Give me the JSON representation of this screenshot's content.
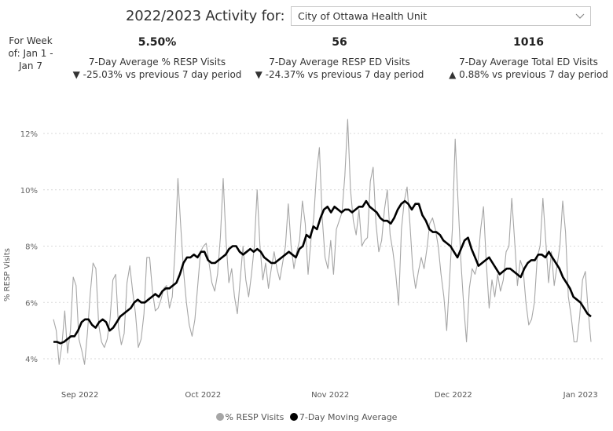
{
  "header": {
    "title": "2022/2023 Activity for:",
    "dropdown_value": "City of Ottawa Health Unit",
    "dropdown_icon": "chevron-down-icon",
    "week_label": "For Week of: Jan 1 - Jan 7"
  },
  "kpis": [
    {
      "value": "5.50%",
      "label": "7-Day Average % RESP Visits",
      "direction": "down",
      "arrow": "▼",
      "change": "-25.03% vs previous 7 day period"
    },
    {
      "value": "56",
      "label": "7-Day Average RESP ED Visits",
      "direction": "down",
      "arrow": "▼",
      "change": "-24.37% vs previous 7 day period"
    },
    {
      "value": "1016",
      "label": "7-Day Average Total ED Visits",
      "direction": "up",
      "arrow": "▲",
      "change": "0.88% vs previous 7 day period"
    }
  ],
  "colors": {
    "raw": "#a6a6a6",
    "avg": "#000000",
    "grid": "#d9d9d9"
  },
  "chart_data": {
    "type": "line",
    "title": "",
    "xlabel": "",
    "ylabel": "% RESP Visits",
    "ylim": [
      4,
      12
    ],
    "yticks": [
      4,
      6,
      8,
      10,
      12
    ],
    "ytick_labels": [
      "4%",
      "6%",
      "8%",
      "10%",
      "12%"
    ],
    "x_start": "2022-08-29",
    "x_end": "2023-01-07",
    "xticks": [
      "2022-09-01",
      "2022-10-01",
      "2022-11-01",
      "2022-12-01",
      "2023-01-01"
    ],
    "xtick_labels": [
      "Sep 2022",
      "Oct 2022",
      "Nov 2022",
      "Dec 2022",
      "Jan 2023"
    ],
    "grid": true,
    "legend_position": "bottom",
    "series": [
      {
        "name": "% RESP Visits",
        "values": [
          5.4,
          5.0,
          3.8,
          4.5,
          5.7,
          4.2,
          5.0,
          6.9,
          6.6,
          4.7,
          4.3,
          3.8,
          4.9,
          6.3,
          7.4,
          7.2,
          5.2,
          4.6,
          4.4,
          4.7,
          5.4,
          6.8,
          7.0,
          5.1,
          4.5,
          4.9,
          6.7,
          7.3,
          6.4,
          5.6,
          4.4,
          4.7,
          5.6,
          7.6,
          7.6,
          6.4,
          5.7,
          5.8,
          6.1,
          6.5,
          6.6,
          5.8,
          6.2,
          7.9,
          10.4,
          8.7,
          7.1,
          6.0,
          5.2,
          4.8,
          5.4,
          6.6,
          7.8,
          8.0,
          8.1,
          7.4,
          6.7,
          6.4,
          7.0,
          8.3,
          10.4,
          8.2,
          6.7,
          7.2,
          6.2,
          5.6,
          6.8,
          8.0,
          6.8,
          6.2,
          7.0,
          8.0,
          10.0,
          8.0,
          6.8,
          7.4,
          6.5,
          7.2,
          7.8,
          7.2,
          6.8,
          7.4,
          8.0,
          9.5,
          8.0,
          7.2,
          7.8,
          8.2,
          9.6,
          8.8,
          7.0,
          8.2,
          9.0,
          10.6,
          11.5,
          9.0,
          7.6,
          7.2,
          8.2,
          7.0,
          8.6,
          8.9,
          9.2,
          10.5,
          12.5,
          10.0,
          8.9,
          8.4,
          9.3,
          8.0,
          8.2,
          8.3,
          10.3,
          10.8,
          8.8,
          7.8,
          8.2,
          9.3,
          10.0,
          8.4,
          7.8,
          7.0,
          5.9,
          8.6,
          9.6,
          10.1,
          8.8,
          7.2,
          6.5,
          7.1,
          7.6,
          7.2,
          7.9,
          8.8,
          9.0,
          8.6,
          8.0,
          7.0,
          6.2,
          5.0,
          6.8,
          8.6,
          11.8,
          9.6,
          7.5,
          5.9,
          4.6,
          6.5,
          7.2,
          7.0,
          7.4,
          8.6,
          9.4,
          7.4,
          5.8,
          6.8,
          6.2,
          7.0,
          6.4,
          6.8,
          7.8,
          8.0,
          9.7,
          8.2,
          6.6,
          7.5,
          7.2,
          6.0,
          5.2,
          5.4,
          6.0,
          7.6,
          8.0,
          9.7,
          8.2,
          6.7,
          7.8,
          6.6,
          7.3,
          8.0,
          9.6,
          8.5,
          6.2,
          5.5,
          4.6,
          4.6,
          5.5,
          6.8,
          7.1,
          5.7,
          4.6
        ]
      },
      {
        "name": "7-Day Moving Average",
        "values": [
          4.6,
          4.6,
          4.55,
          4.6,
          4.7,
          4.8,
          4.8,
          5.0,
          5.3,
          5.4,
          5.4,
          5.2,
          5.1,
          5.3,
          5.4,
          5.3,
          5.0,
          5.1,
          5.3,
          5.5,
          5.6,
          5.7,
          5.8,
          6.0,
          6.1,
          6.0,
          6.0,
          6.1,
          6.2,
          6.3,
          6.2,
          6.4,
          6.5,
          6.5,
          6.6,
          6.7,
          7.0,
          7.4,
          7.6,
          7.6,
          7.7,
          7.6,
          7.8,
          7.8,
          7.5,
          7.4,
          7.4,
          7.5,
          7.6,
          7.7,
          7.9,
          8.0,
          8.0,
          7.8,
          7.7,
          7.8,
          7.9,
          7.8,
          7.9,
          7.8,
          7.6,
          7.5,
          7.4,
          7.4,
          7.5,
          7.6,
          7.7,
          7.8,
          7.7,
          7.6,
          7.9,
          8.0,
          8.4,
          8.3,
          8.7,
          8.6,
          9.0,
          9.3,
          9.4,
          9.2,
          9.4,
          9.3,
          9.2,
          9.3,
          9.3,
          9.2,
          9.3,
          9.4,
          9.4,
          9.6,
          9.4,
          9.3,
          9.2,
          9.0,
          8.9,
          8.9,
          8.8,
          9.0,
          9.3,
          9.5,
          9.6,
          9.5,
          9.3,
          9.5,
          9.5,
          9.1,
          8.9,
          8.6,
          8.5,
          8.5,
          8.4,
          8.2,
          8.1,
          8.0,
          7.8,
          7.6,
          7.9,
          8.2,
          8.3,
          7.9,
          7.6,
          7.3,
          7.4,
          7.5,
          7.6,
          7.4,
          7.2,
          7.0,
          7.1,
          7.2,
          7.2,
          7.1,
          7.0,
          6.9,
          7.2,
          7.4,
          7.5,
          7.5,
          7.7,
          7.7,
          7.6,
          7.8,
          7.6,
          7.4,
          7.2,
          6.9,
          6.7,
          6.5,
          6.2,
          6.1,
          6.0,
          5.8,
          5.6,
          5.5
        ]
      }
    ]
  }
}
